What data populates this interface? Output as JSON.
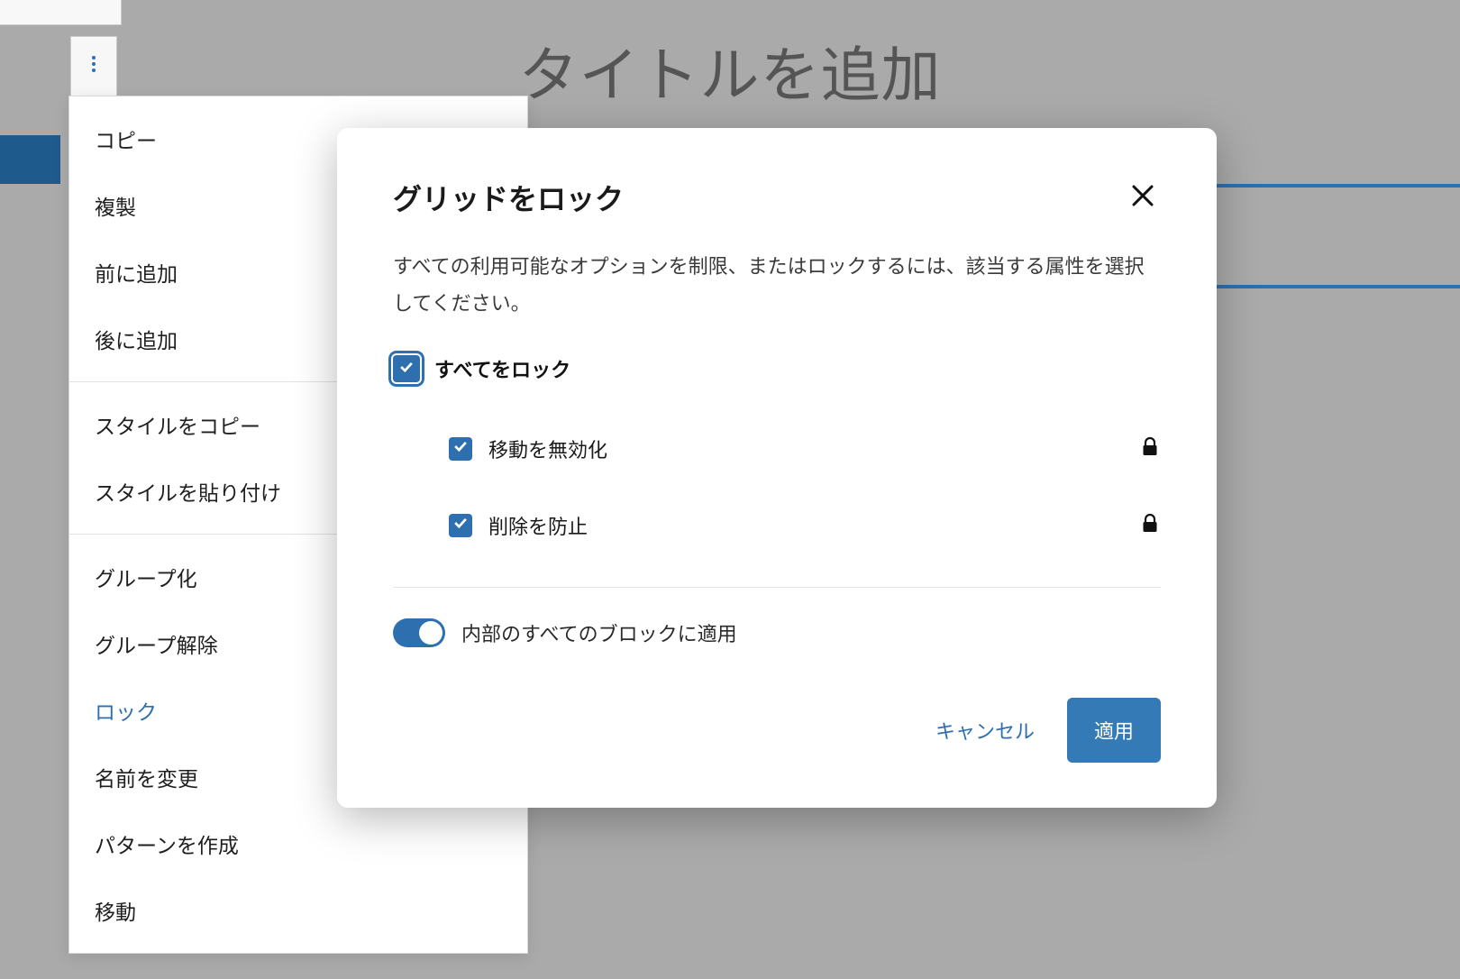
{
  "editor": {
    "title_placeholder": "タイトルを追加"
  },
  "context_menu": {
    "groups": [
      [
        "コピー",
        "複製",
        "前に追加",
        "後に追加"
      ],
      [
        "スタイルをコピー",
        "スタイルを貼り付け"
      ],
      [
        "グループ化",
        "グループ解除",
        "ロック",
        "名前を変更",
        "パターンを作成",
        "移動"
      ]
    ],
    "active_item": "ロック"
  },
  "modal": {
    "title": "グリッドをロック",
    "description": "すべての利用可能なオプションを制限、またはロックするには、該当する属性を選択してください。",
    "lock_all_label": "すべてをロック",
    "lock_all_checked": true,
    "options": [
      {
        "label": "移動を無効化",
        "checked": true,
        "locked": true
      },
      {
        "label": "削除を防止",
        "checked": true,
        "locked": true
      }
    ],
    "apply_inner_label": "内部のすべてのブロックに適用",
    "apply_inner_on": true,
    "cancel_label": "キャンセル",
    "apply_label": "適用"
  }
}
